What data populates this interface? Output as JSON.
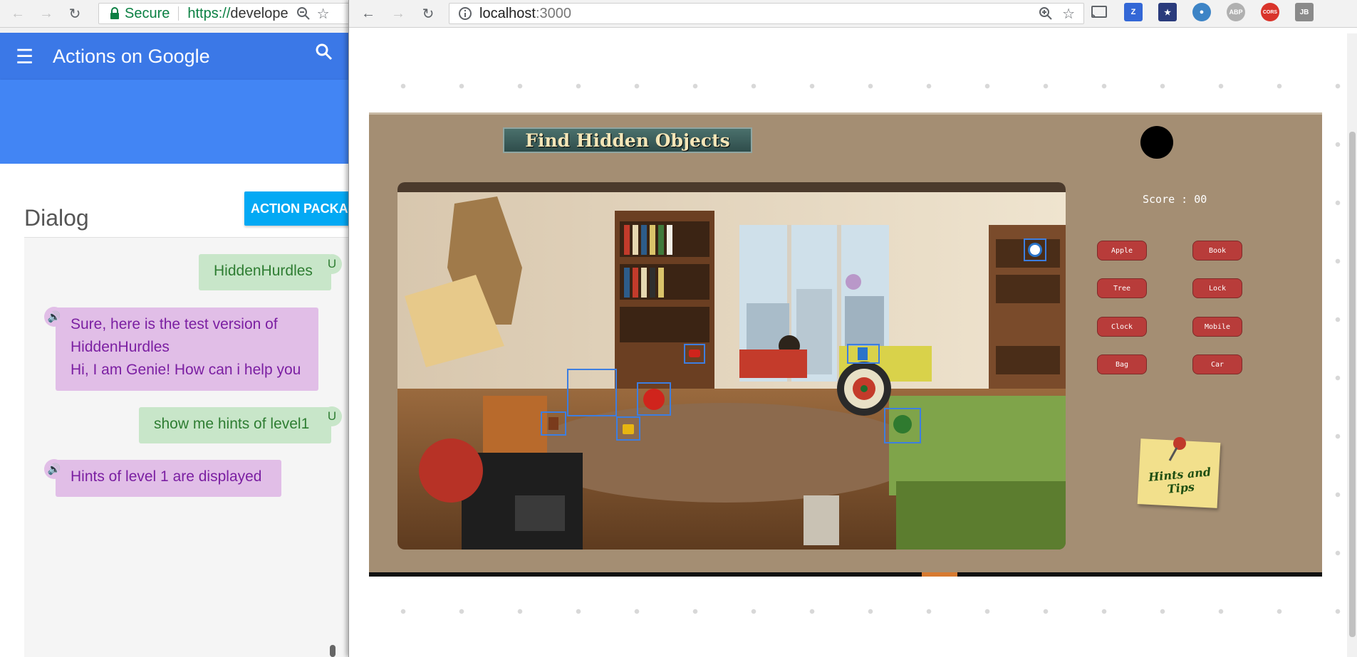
{
  "left_window": {
    "address_bar": {
      "secure_label": "Secure",
      "url_scheme": "https://",
      "url_rest": "develope"
    },
    "app_bar": {
      "title": "Actions on Google"
    },
    "action_package_button": "ACTION PACKAG",
    "dialog": {
      "title": "Dialog",
      "messages": [
        {
          "role": "user",
          "lines": [
            "HiddenHurdles"
          ],
          "badge": "U"
        },
        {
          "role": "bot",
          "lines": [
            "Sure, here is the test version of",
            "HiddenHurdles",
            "Hi, I am Genie! How can i help you"
          ]
        },
        {
          "role": "user",
          "lines": [
            "show me hints of level1"
          ],
          "badge": "U"
        },
        {
          "role": "bot",
          "lines": [
            "Hints of level 1 are displayed"
          ]
        }
      ]
    }
  },
  "right_window": {
    "address_bar": {
      "host": "localhost",
      "port": ":3000"
    },
    "extensions": [
      {
        "icon": "cast-icon",
        "label": "",
        "color": "#5f6368"
      },
      {
        "icon": "z-extension-icon",
        "label": "Z",
        "color": "#3367d6"
      },
      {
        "icon": "sheriff-extension-icon",
        "label": "",
        "color": "#2a3b7c"
      },
      {
        "icon": "globe-extension-icon",
        "label": "",
        "color": "#3d84c6"
      },
      {
        "icon": "adblock-icon",
        "label": "ABP",
        "color": "#b0b0b0"
      },
      {
        "icon": "cors-icon",
        "label": "CORS",
        "color": "#d9342b"
      },
      {
        "icon": "jb-extension-icon",
        "label": "JB",
        "color": "#8a8a8a"
      }
    ],
    "game": {
      "title": "Find Hidden Objects",
      "score_label": "Score : 00",
      "hints": [
        "Apple",
        "Book",
        "Tree",
        "Lock",
        "Clock",
        "Mobile",
        "Bag",
        "Car"
      ],
      "note_label": "Hints and Tips"
    }
  },
  "colors": {
    "aog_blue": "#3b78e7",
    "user_bubble": "#c8e6c9",
    "bot_bubble": "#e1bee7",
    "game_bg": "#a48e73",
    "hint_button": "#b83c3a"
  }
}
